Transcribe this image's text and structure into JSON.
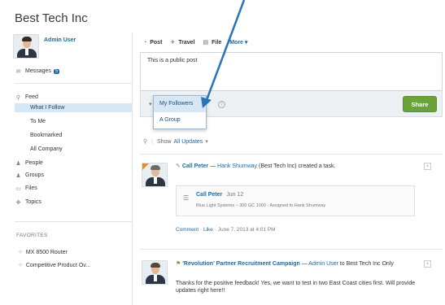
{
  "app": {
    "title": "Best Tech Inc"
  },
  "sidebar": {
    "user_name": "Admin User",
    "messages_label": "Messages",
    "messages_count": "5",
    "feed_label": "Feed",
    "feed_items": [
      "What I Follow",
      "To Me",
      "Bookmarked",
      "All Company"
    ],
    "nav": [
      {
        "label": "People",
        "icon": "people-icon"
      },
      {
        "label": "Groups",
        "icon": "groups-icon"
      },
      {
        "label": "Files",
        "icon": "files-icon"
      },
      {
        "label": "Topics",
        "icon": "topics-icon"
      }
    ],
    "favorites_header": "FAVORITES",
    "favorites": [
      "MX 8500 Router",
      "Competitive Product Ov..."
    ]
  },
  "publisher": {
    "tabs": [
      "Post",
      "Travel",
      "File"
    ],
    "more_label": "More ▾",
    "post_text": "This is a public post",
    "share_label": "Share",
    "visibility_options": [
      "My Followers",
      "A Group"
    ]
  },
  "feed": {
    "show_label": "Show",
    "filter_value": "All Updates",
    "posts": [
      {
        "author": "Call Peter",
        "dash": "—",
        "target": "Hank Shumway",
        "company": "(Best Tech Inc)",
        "action": "created a task.",
        "task_title": "Call Peter",
        "task_date": "Jun 12",
        "task_detail": "Blue Light Systems – 300 GC 1000 · Assigned to Hank Shumway",
        "comment_label": "Comment",
        "like_label": "Like",
        "timestamp": "June 7, 2013 at 4:01 PM"
      },
      {
        "campaign": "'Revolution' Partner Recruitment Campaign",
        "dash": "—",
        "author": "Admin User",
        "to_text": "to",
        "to_target": "Best Tech Inc Only",
        "message": "Thanks for the positive feedback! Yes, we want to test in two East Coast cities first. Will provide updates right here!!"
      }
    ]
  }
}
